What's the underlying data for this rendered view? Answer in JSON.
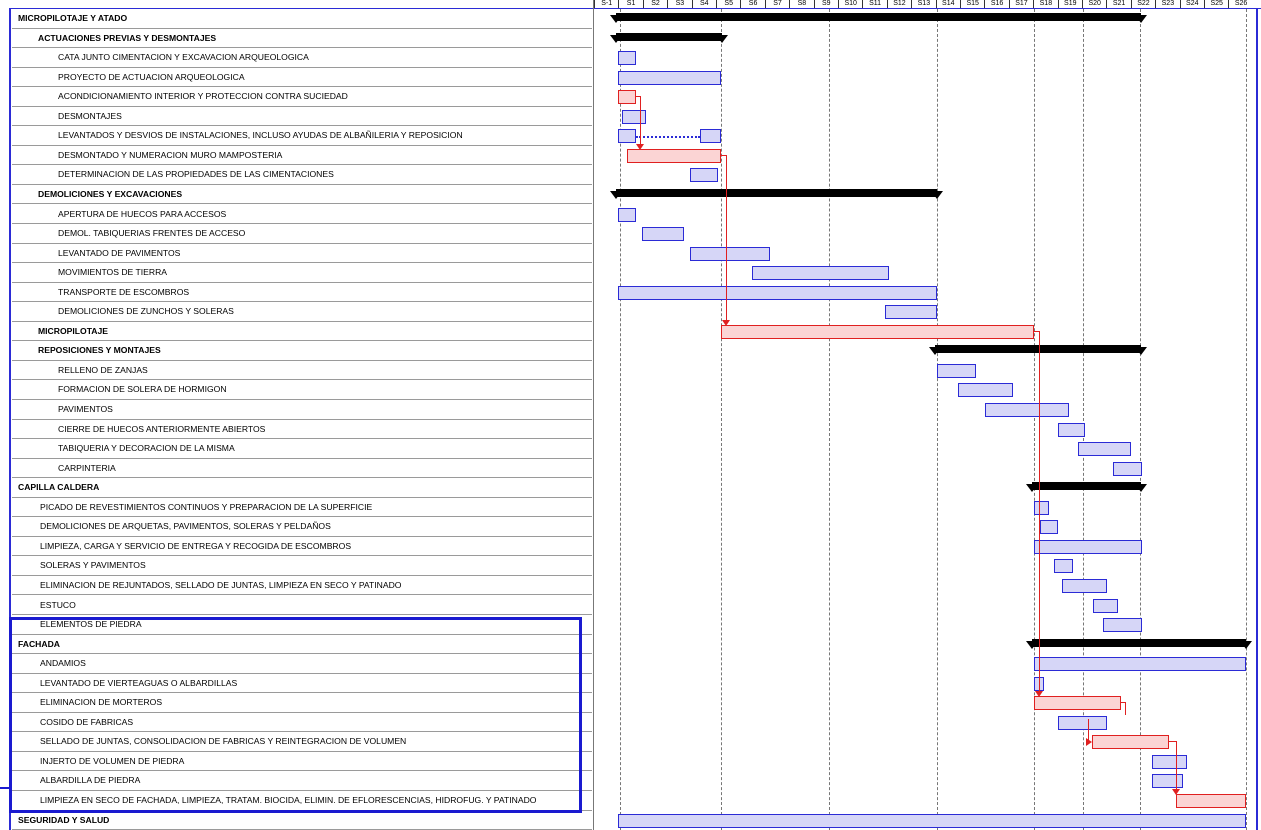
{
  "header": {
    "weeks": [
      "S-1",
      "S1",
      "S2",
      "S3",
      "S4",
      "S5",
      "S6",
      "S7",
      "S8",
      "S9",
      "S10",
      "S11",
      "S12",
      "S13",
      "S14",
      "S15",
      "S16",
      "S17",
      "S18",
      "S19",
      "S20",
      "S21",
      "S22",
      "S23",
      "S24",
      "S25",
      "S26"
    ]
  },
  "tasks": [
    {
      "label": "MICROPILOTAJE Y ATADO",
      "level": 0,
      "bold": true
    },
    {
      "label": "ACTUACIONES PREVIAS Y DESMONTAJES",
      "level": 1,
      "bold": true
    },
    {
      "label": "CATA JUNTO CIMENTACION Y EXCAVACION ARQUEOLOGICA",
      "level": 2,
      "bold": false
    },
    {
      "label": "PROYECTO DE ACTUACION ARQUEOLOGICA",
      "level": 2,
      "bold": false
    },
    {
      "label": "ACONDICIONAMIENTO INTERIOR Y PROTECCION CONTRA SUCIEDAD",
      "level": 2,
      "bold": false
    },
    {
      "label": "DESMONTAJES",
      "level": 2,
      "bold": false
    },
    {
      "label": "LEVANTADOS  Y DESVIOS DE INSTALACIONES, INCLUSO AYUDAS DE ALBAÑILERIA Y REPOSICION",
      "level": 2,
      "bold": false
    },
    {
      "label": "DESMONTADO Y NUMERACION MURO MAMPOSTERIA",
      "level": 2,
      "bold": false
    },
    {
      "label": "DETERMINACION DE LAS PROPIEDADES DE LAS CIMENTACIONES",
      "level": 2,
      "bold": false
    },
    {
      "label": "DEMOLICIONES Y EXCAVACIONES",
      "level": 1,
      "bold": true
    },
    {
      "label": "APERTURA DE HUECOS PARA ACCESOS",
      "level": 2,
      "bold": false
    },
    {
      "label": "DEMOL. TABIQUERIAS FRENTES DE ACCESO",
      "level": 2,
      "bold": false
    },
    {
      "label": "LEVANTADO DE PAVIMENTOS",
      "level": 2,
      "bold": false
    },
    {
      "label": "MOVIMIENTOS DE TIERRA",
      "level": 2,
      "bold": false
    },
    {
      "label": "TRANSPORTE DE ESCOMBROS",
      "level": 2,
      "bold": false
    },
    {
      "label": "DEMOLICIONES DE ZUNCHOS Y SOLERAS",
      "level": 2,
      "bold": false
    },
    {
      "label": "MICROPILOTAJE",
      "level": 1,
      "bold": true
    },
    {
      "label": "REPOSICIONES Y MONTAJES",
      "level": 1,
      "bold": true
    },
    {
      "label": "RELLENO DE ZANJAS",
      "level": 2,
      "bold": false
    },
    {
      "label": "FORMACION DE SOLERA DE HORMIGON",
      "level": 2,
      "bold": false
    },
    {
      "label": "PAVIMENTOS",
      "level": 2,
      "bold": false
    },
    {
      "label": "CIERRE DE HUECOS ANTERIORMENTE ABIERTOS",
      "level": 2,
      "bold": false
    },
    {
      "label": "TABIQUERIA Y DECORACION DE LA MISMA",
      "level": 2,
      "bold": false
    },
    {
      "label": "CARPINTERIA",
      "level": 2,
      "bold": false
    },
    {
      "label": "CAPILLA CALDERA",
      "level": 0,
      "bold": true
    },
    {
      "label": "PICADO DE REVESTIMIENTOS CONTINUOS Y PREPARACION DE LA SUPERFICIE",
      "level": 3,
      "bold": false
    },
    {
      "label": "DEMOLICIONES DE ARQUETAS, PAVIMENTOS, SOLERAS Y PELDAÑOS",
      "level": 3,
      "bold": false
    },
    {
      "label": "LIMPIEZA, CARGA Y SERVICIO DE ENTREGA Y RECOGIDA DE ESCOMBROS",
      "level": 3,
      "bold": false
    },
    {
      "label": "SOLERAS Y PAVIMENTOS",
      "level": 3,
      "bold": false
    },
    {
      "label": "ELIMINACION DE REJUNTADOS, SELLADO DE JUNTAS, LIMPIEZA EN SECO Y PATINADO",
      "level": 3,
      "bold": false
    },
    {
      "label": "ESTUCO",
      "level": 3,
      "bold": false
    },
    {
      "label": "ELEMENTOS DE PIEDRA",
      "level": 3,
      "bold": false
    },
    {
      "label": "FACHADA",
      "level": 0,
      "bold": true
    },
    {
      "label": "ANDAMIOS",
      "level": 3,
      "bold": false
    },
    {
      "label": "LEVANTADO DE VIERTEAGUAS O ALBARDILLAS",
      "level": 3,
      "bold": false
    },
    {
      "label": "ELIMINACION DE MORTEROS",
      "level": 3,
      "bold": false
    },
    {
      "label": "COSIDO DE FABRICAS",
      "level": 3,
      "bold": false
    },
    {
      "label": "SELLADO DE JUNTAS, CONSOLIDACION  DE FABRICAS Y REINTEGRACION DE VOLUMEN",
      "level": 3,
      "bold": false
    },
    {
      "label": "INJERTO DE VOLUMEN DE PIEDRA",
      "level": 3,
      "bold": false
    },
    {
      "label": "ALBARDILLA DE PIEDRA",
      "level": 3,
      "bold": false
    },
    {
      "label": "LIMPIEZA EN SECO DE FACHADA, LIMPIEZA, TRATAM. BIOCIDA, ELIMIN. DE EFLORESCENCIAS, HIDROFUG. Y PATINADO",
      "level": 3,
      "bold": false
    },
    {
      "label": "SEGURIDAD Y SALUD",
      "level": 0,
      "bold": true
    }
  ],
  "colors": {
    "task": "#d6d6f7",
    "critical": "#fbd4d4",
    "border_blue": "#2b2bd6",
    "border_red": "#e02020",
    "summary": "#000000"
  }
}
